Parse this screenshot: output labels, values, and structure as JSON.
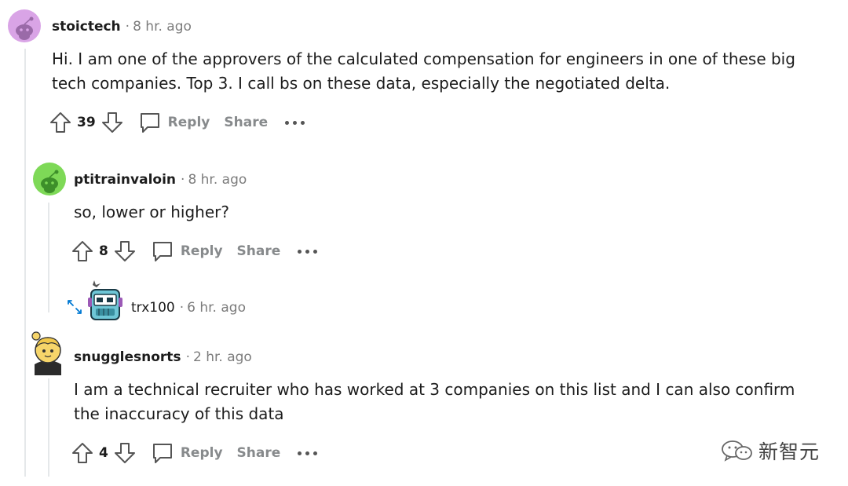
{
  "comments": [
    {
      "author": "stoictech",
      "time": "8 hr. ago",
      "lines": [
        "Hi. I am one of the approvers of the calculated compensation for engineers in one of these big",
        "tech companies. Top 3. I call bs on these data, especially the negotiated delta."
      ],
      "score": "39",
      "reply_label": "Reply",
      "share_label": "Share"
    },
    {
      "author": "ptitrainvaloin",
      "time": "8 hr. ago",
      "lines": [
        "so, lower or higher?"
      ],
      "score": "8",
      "reply_label": "Reply",
      "share_label": "Share"
    },
    {
      "author": "trx100",
      "time": "6 hr. ago"
    },
    {
      "author": "snugglesnorts",
      "time": "2 hr. ago",
      "lines": [
        "I am a technical recruiter who has worked at 3 companies on this list and I can also confirm",
        "the inaccuracy of this data"
      ],
      "score": "4",
      "reply_label": "Reply",
      "share_label": "Share"
    }
  ],
  "watermark": "新智元",
  "colors": {
    "avatar_1": "#d9a4e6",
    "avatar_2": "#7ed957",
    "meta_gray": "#7c7c7c",
    "action_gray": "#878a8c",
    "thread_line": "#e5e8ea"
  },
  "icons": [
    "reddit-snoo-avatar",
    "upvote-arrow",
    "downvote-arrow",
    "comment-bubble",
    "ellipsis",
    "expand-arrows",
    "wechat-logo"
  ]
}
